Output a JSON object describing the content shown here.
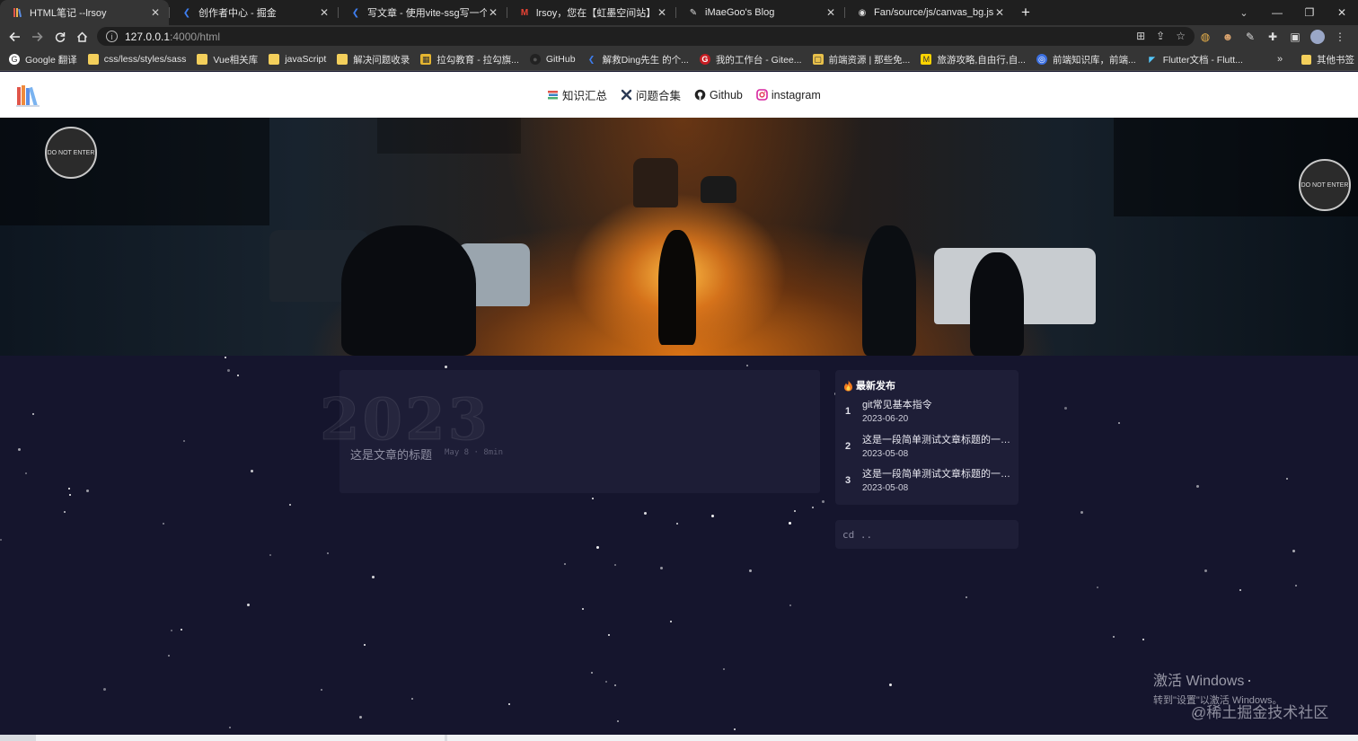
{
  "browser": {
    "tabs": [
      {
        "title": "HTML笔记 --lrsoy",
        "icon": "books-logo-icon",
        "active": true
      },
      {
        "title": "创作者中心 - 掘金",
        "icon": "juejin-icon",
        "active": false
      },
      {
        "title": "写文章 - 使用vite-ssg写一个存放",
        "icon": "juejin-icon",
        "active": false
      },
      {
        "title": "lrsoy，您在【虹墨空间站】上的",
        "icon": "gmail-icon",
        "active": false
      },
      {
        "title": "iMaeGoo's Blog",
        "icon": "feather-icon",
        "active": false
      },
      {
        "title": "Fan/source/js/canvas_bg.js at",
        "icon": "github-icon",
        "active": false
      }
    ],
    "new_tab_symbol": "+",
    "window_controls": [
      "⌄",
      "—",
      "❐",
      "✕"
    ],
    "address": {
      "host": "127.0.0.1",
      "path": ":4000/html"
    },
    "bookmarks": [
      {
        "label": "Google 翻译",
        "icon": "google-translate-icon"
      },
      {
        "label": "css/less/styles/sass",
        "icon": "folder-icon"
      },
      {
        "label": "Vue相关库",
        "icon": "folder-icon"
      },
      {
        "label": "javaScript",
        "icon": "folder-icon"
      },
      {
        "label": "解决问题收录",
        "icon": "folder-icon"
      },
      {
        "label": "拉勾教育 - 拉勾旗...",
        "icon": "lagou-icon"
      },
      {
        "label": "GitHub",
        "icon": "github-icon"
      },
      {
        "label": "解救Ding先生 的个...",
        "icon": "juejin-icon"
      },
      {
        "label": "我的工作台 - Gitee...",
        "icon": "gitee-icon"
      },
      {
        "label": "前端资源 | 那些免...",
        "icon": "resource-icon"
      },
      {
        "label": "旅游攻略,自由行,自...",
        "icon": "mafengwo-icon"
      },
      {
        "label": "前端知识库，前端...",
        "icon": "knowledge-icon"
      },
      {
        "label": "Flutter文档 - Flutt...",
        "icon": "flutter-icon"
      }
    ],
    "bookmarks_more": "»",
    "other_bookmarks": "其他书签"
  },
  "site": {
    "nav": [
      {
        "label": "知识汇总",
        "icon": "books-icon"
      },
      {
        "label": "问题合集",
        "icon": "tools-icon"
      },
      {
        "label": "Github",
        "icon": "github-icon"
      },
      {
        "label": "instagram",
        "icon": "instagram-icon"
      }
    ]
  },
  "post": {
    "year": "2023",
    "title": "这是文章的标题",
    "meta": "May 8 · 8min"
  },
  "latest": {
    "heading": "最新发布",
    "items": [
      {
        "num": "1",
        "title": "git常见基本指令",
        "date": "2023-06-20"
      },
      {
        "num": "2",
        "title": "这是一段简单测试文章标题的一段话",
        "date": "2023-05-08"
      },
      {
        "num": "3",
        "title": "这是一段简单测试文章标题的一段话",
        "date": "2023-05-08"
      }
    ]
  },
  "cd_link": "cd ..",
  "overlay": {
    "activate_title": "激活 Windows",
    "activate_sub": "转到\"设置\"以激活 Windows。",
    "credit": "@稀土掘金技术社区"
  },
  "hero_signs": [
    "DO NOT ENTER",
    "DO NOT ENTER"
  ]
}
